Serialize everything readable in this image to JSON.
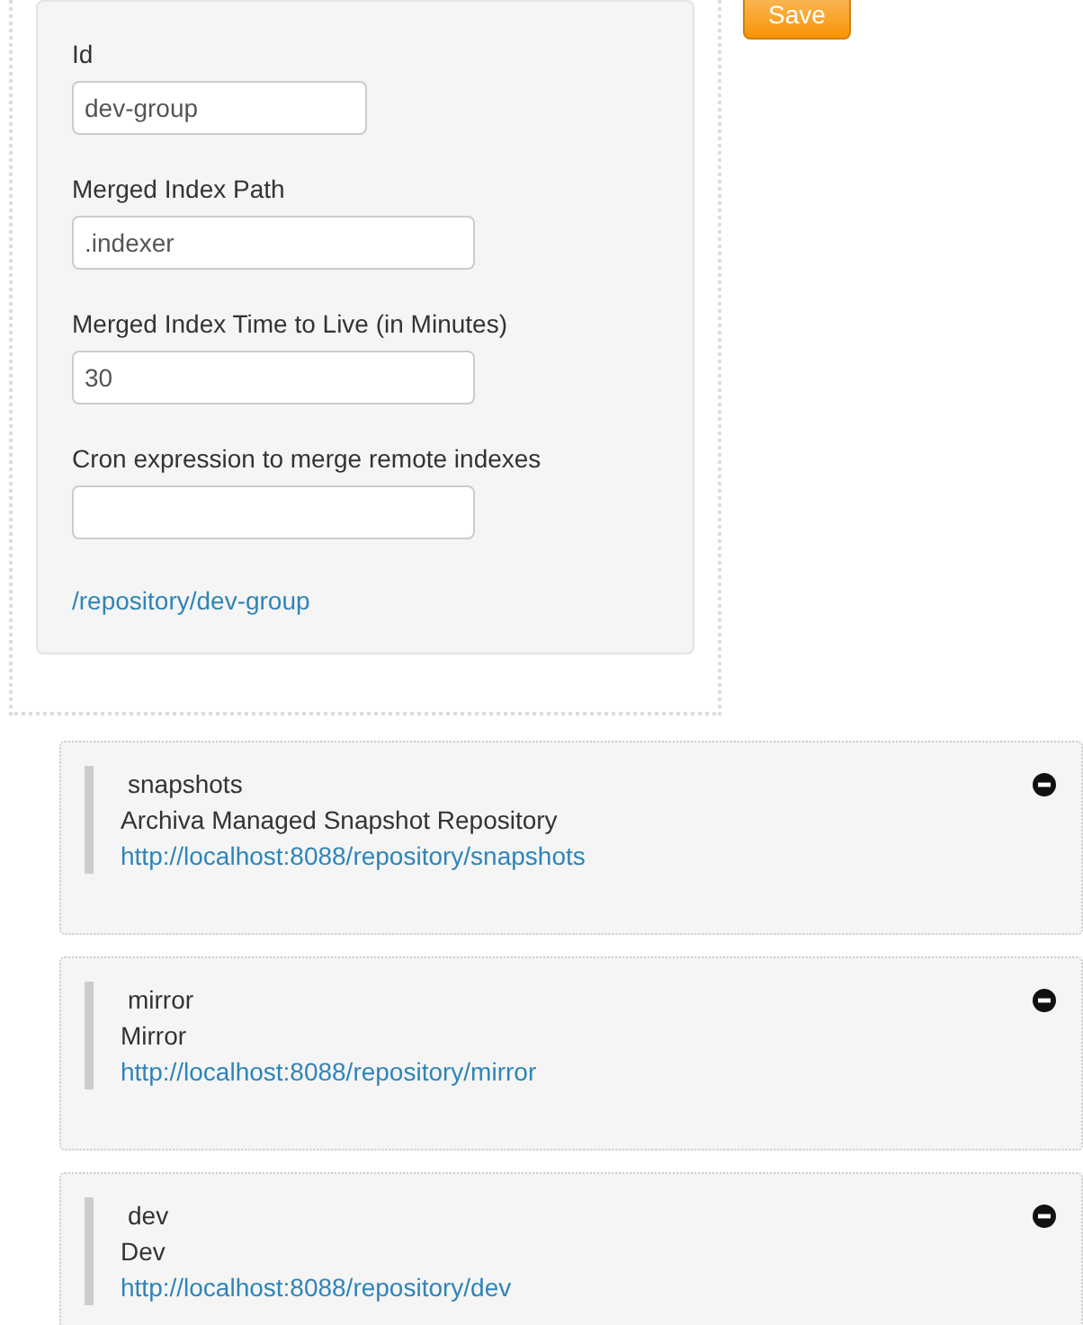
{
  "form": {
    "fields": [
      {
        "label": "Id",
        "value": "dev-group"
      },
      {
        "label": "Merged Index Path",
        "value": ".indexer"
      },
      {
        "label": "Merged Index Time to Live (in Minutes)",
        "value": "30"
      },
      {
        "label": "Cron expression to merge remote indexes"
      }
    ],
    "link": "/repository/dev-group"
  },
  "save_button": "Save",
  "repositories": [
    {
      "name": "snapshots",
      "description": "Archiva Managed Snapshot Repository",
      "url": "http://localhost:8088/repository/snapshots"
    },
    {
      "name": "mirror",
      "description": "Mirror",
      "url": "http://localhost:8088/repository/mirror"
    },
    {
      "name": "dev",
      "description": "Dev",
      "url": "http://localhost:8088/repository/dev"
    }
  ]
}
